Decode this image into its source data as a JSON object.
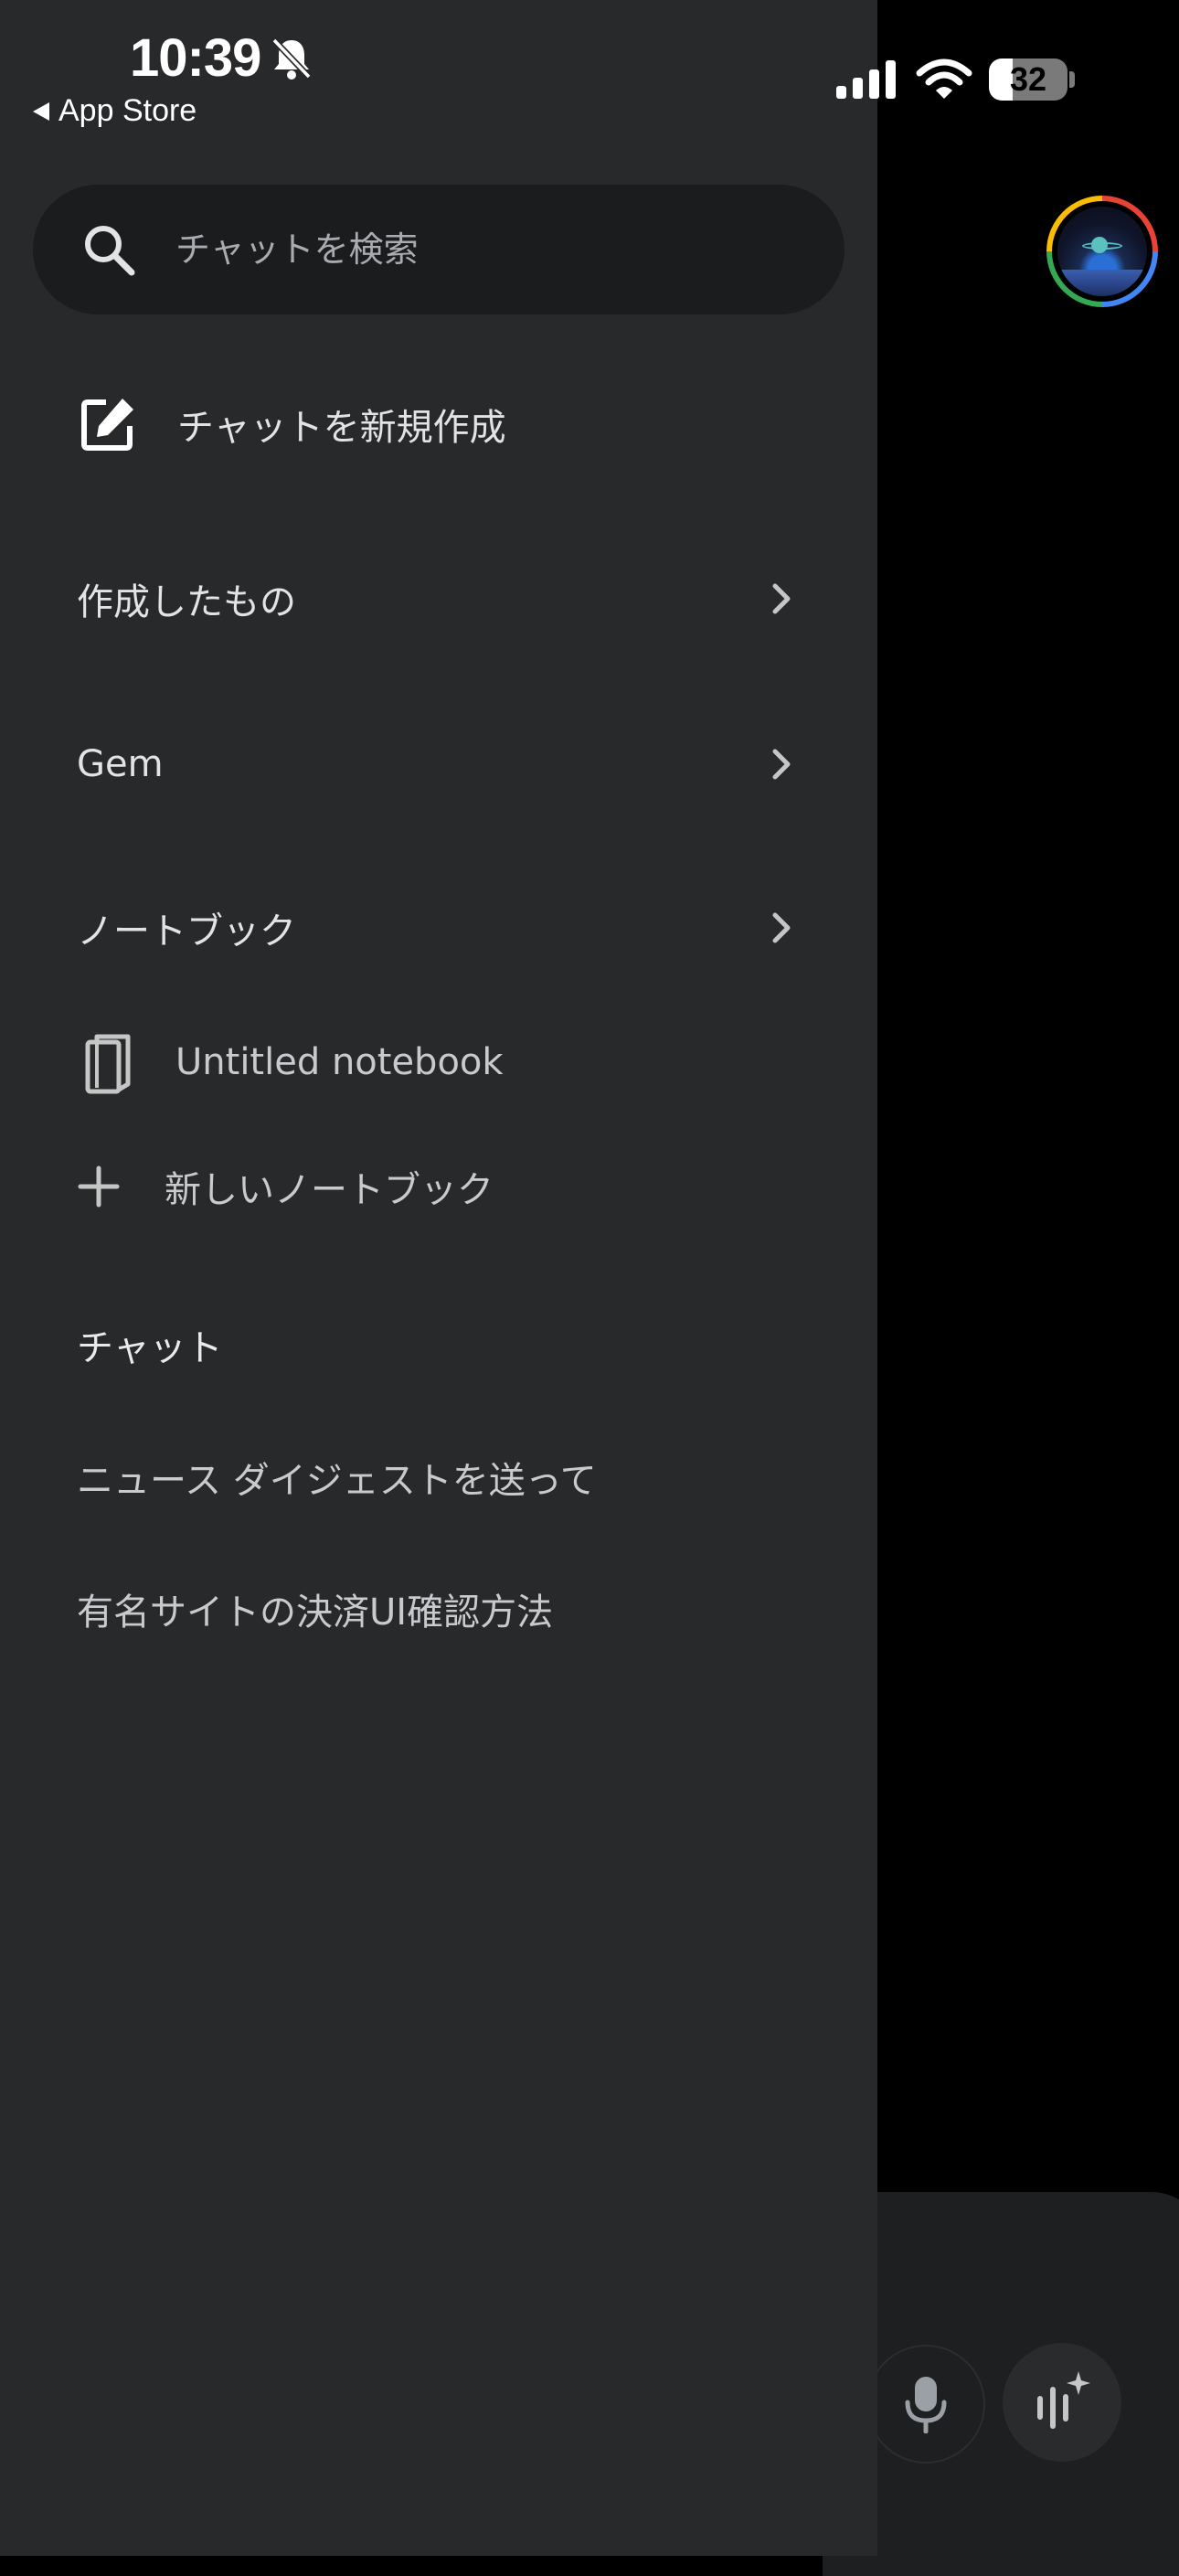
{
  "status_bar": {
    "time": "10:39",
    "back_app": "App Store",
    "battery": "32"
  },
  "drawer": {
    "search": {
      "placeholder": "チャットを検索"
    },
    "new_chat_label": "チャットを新規作成",
    "nav": [
      {
        "label": "作成したもの"
      },
      {
        "label": "Gem"
      },
      {
        "label": "ノートブック"
      }
    ],
    "notebooks": {
      "items": [
        {
          "label": "Untitled notebook"
        }
      ],
      "new_label": "新しいノートブック"
    },
    "chats": {
      "header": "チャット",
      "items": [
        {
          "label": "ニュース ダイジェストを送って"
        },
        {
          "label": "有名サイトの決済UI確認方法"
        }
      ]
    }
  },
  "colors": {
    "drawer_bg": "#28292b",
    "search_bg": "#1b1c1d",
    "background": "#000000"
  },
  "icons": [
    "bell-slash-icon",
    "signal-icon",
    "wifi-icon",
    "battery-icon",
    "search-icon",
    "edit-icon",
    "chevron-right-icon",
    "notebook-icon",
    "plus-icon",
    "mic-icon",
    "gemini-live-icon"
  ]
}
